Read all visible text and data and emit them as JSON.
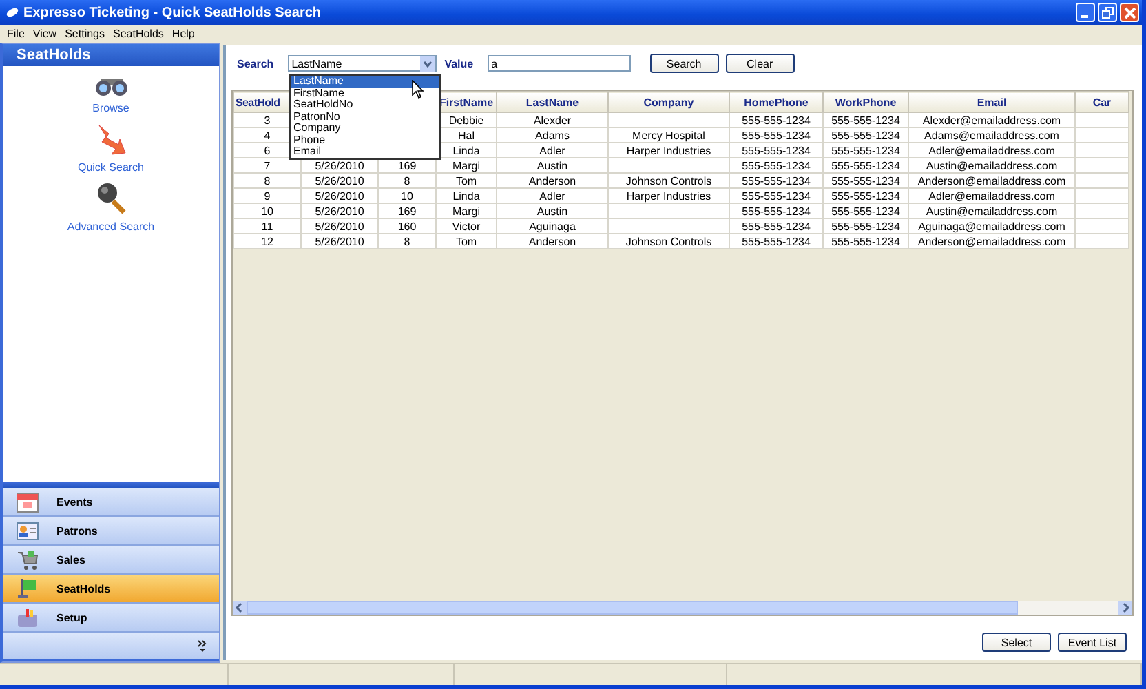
{
  "window": {
    "title": "Expresso Ticketing - Quick SeatHolds Search"
  },
  "menu": [
    "File",
    "View",
    "Settings",
    "SeatHolds",
    "Help"
  ],
  "sidebar": {
    "title": "SeatHolds",
    "links": [
      {
        "label": "Browse",
        "kind": "browse"
      },
      {
        "label": "Quick Search",
        "kind": "quick"
      },
      {
        "label": "Advanced Search",
        "kind": "advanced"
      }
    ]
  },
  "nav": [
    {
      "label": "Events",
      "kind": "events",
      "selected": false
    },
    {
      "label": "Patrons",
      "kind": "patrons",
      "selected": false
    },
    {
      "label": "Sales",
      "kind": "sales",
      "selected": false
    },
    {
      "label": "SeatHolds",
      "kind": "seatholds",
      "selected": true
    },
    {
      "label": "Setup",
      "kind": "setup",
      "selected": false
    }
  ],
  "search": {
    "label": "Search",
    "field": "LastName",
    "value_label": "Value",
    "value": "a",
    "buttons": [
      "Search",
      "Clear"
    ]
  },
  "dropdown": {
    "items": [
      {
        "label": "LastName",
        "selected": true
      },
      {
        "label": "FirstName",
        "selected": false
      },
      {
        "label": "SeatHoldNo",
        "selected": false
      },
      {
        "label": "PatronNo",
        "selected": false
      },
      {
        "label": "Company",
        "selected": false
      },
      {
        "label": "Phone",
        "selected": false
      },
      {
        "label": "Email",
        "selected": false
      }
    ]
  },
  "table": {
    "columns": [
      "SeatHold",
      null,
      null,
      "FirstName",
      "LastName",
      "Company",
      "HomePhone",
      "WorkPhone",
      "Email",
      "Car"
    ],
    "rows": [
      [
        "3",
        null,
        null,
        "Debbie",
        "Alexder",
        null,
        "555-555-1234",
        "555-555-1234",
        "Alexder@emailaddress.com",
        null
      ],
      [
        "4",
        null,
        null,
        "Hal",
        "Adams",
        "Mercy Hospital",
        "555-555-1234",
        "555-555-1234",
        "Adams@emailaddress.com",
        null
      ],
      [
        "6",
        null,
        null,
        "Linda",
        "Adler",
        "Harper Industries",
        "555-555-1234",
        "555-555-1234",
        "Adler@emailaddress.com",
        null
      ],
      [
        "7",
        "5/26/2010",
        "169",
        "Margi",
        "Austin",
        null,
        "555-555-1234",
        "555-555-1234",
        "Austin@emailaddress.com",
        null
      ],
      [
        "8",
        "5/26/2010",
        "8",
        "Tom",
        "Anderson",
        "Johnson Controls",
        "555-555-1234",
        "555-555-1234",
        "Anderson@emailaddress.com",
        null
      ],
      [
        "9",
        "5/26/2010",
        "10",
        "Linda",
        "Adler",
        "Harper Industries",
        "555-555-1234",
        "555-555-1234",
        "Adler@emailaddress.com",
        null
      ],
      [
        "10",
        "5/26/2010",
        "169",
        "Margi",
        "Austin",
        null,
        "555-555-1234",
        "555-555-1234",
        "Austin@emailaddress.com",
        null
      ],
      [
        "11",
        "5/26/2010",
        "160",
        "Victor",
        "Aguinaga",
        null,
        "555-555-1234",
        "555-555-1234",
        "Aguinaga@emailaddress.com",
        null
      ],
      [
        "12",
        "5/26/2010",
        "8",
        "Tom",
        "Anderson",
        "Johnson Controls",
        "555-555-1234",
        "555-555-1234",
        "Anderson@emailaddress.com",
        null
      ]
    ]
  },
  "buttons": [
    "Select",
    "Event List"
  ]
}
